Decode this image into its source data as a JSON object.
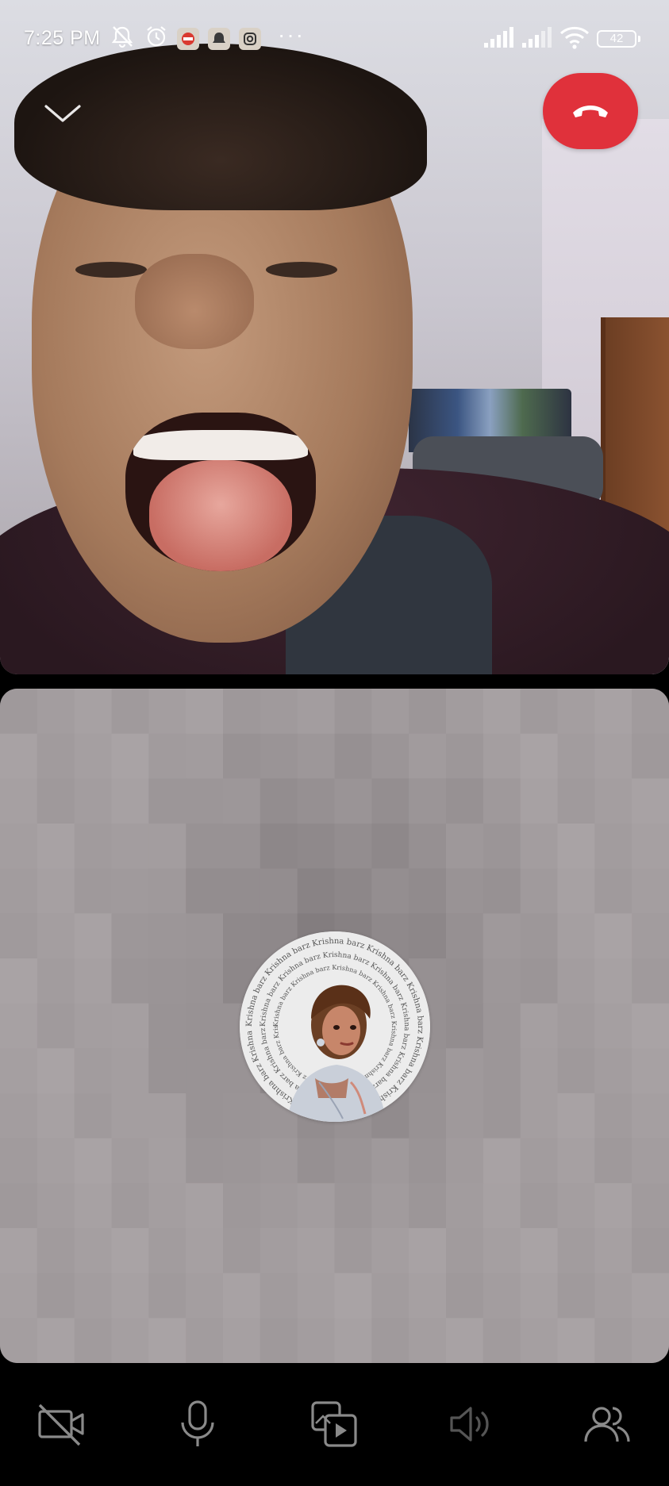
{
  "status_bar": {
    "time": "7:25 PM",
    "battery": "42",
    "icons": [
      "mute-notifications-icon",
      "alarm-icon",
      "app-badge-1",
      "app-badge-2",
      "app-badge-3",
      "more-dots-icon",
      "signal-icon",
      "signal-icon-2",
      "wifi-icon",
      "battery-icon"
    ],
    "more": "···"
  },
  "call": {
    "end_call_color": "#e0313b",
    "self_avatar_text": "Krishna barz"
  },
  "toolbar": {
    "buttons": [
      {
        "name": "camera-off-button",
        "icon": "camera-off-icon"
      },
      {
        "name": "microphone-button",
        "icon": "microphone-icon"
      },
      {
        "name": "share-media-button",
        "icon": "media-play-icon"
      },
      {
        "name": "speaker-button",
        "icon": "speaker-icon"
      },
      {
        "name": "participants-button",
        "icon": "people-icon"
      }
    ]
  }
}
